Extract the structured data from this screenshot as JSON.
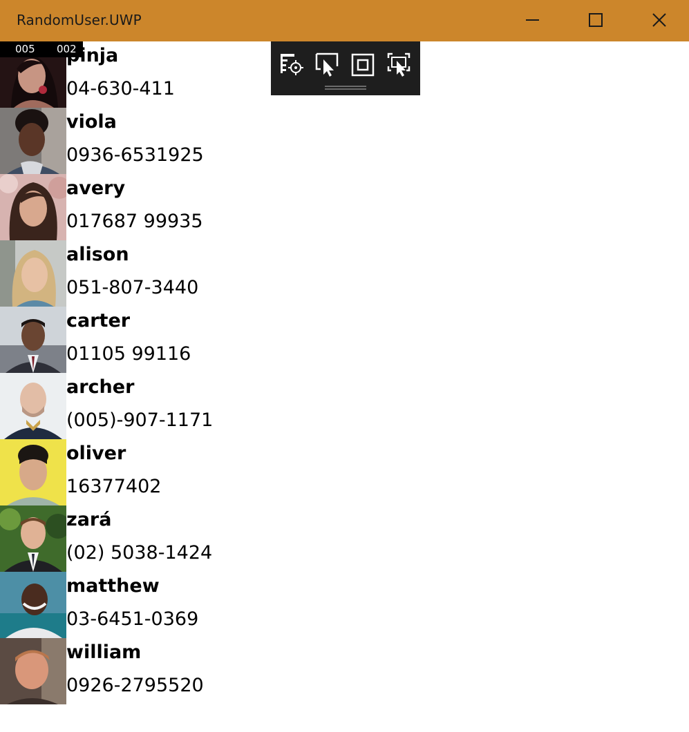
{
  "window": {
    "title": "RandomUser.UWP",
    "accent_color": "#cc862b",
    "controls": {
      "minimize_icon": "minimize-icon",
      "maximize_icon": "maximize-icon",
      "close_icon": "close-icon"
    }
  },
  "frame_counter": {
    "left_value": "005",
    "right_value": "002"
  },
  "debug_toolbar": {
    "tools": [
      {
        "icon": "go-to-live-visual-tree-icon"
      },
      {
        "icon": "select-element-icon"
      },
      {
        "icon": "display-layout-adorners-icon"
      },
      {
        "icon": "track-focused-element-icon"
      }
    ]
  },
  "users": [
    {
      "name": "pinja",
      "phone": "04-630-411",
      "avatar": "user-photo"
    },
    {
      "name": "viola",
      "phone": "0936-6531925",
      "avatar": "user-photo"
    },
    {
      "name": "avery",
      "phone": "017687 99935",
      "avatar": "user-photo"
    },
    {
      "name": "alison",
      "phone": "051-807-3440",
      "avatar": "user-photo"
    },
    {
      "name": "carter",
      "phone": "01105 99116",
      "avatar": "user-photo"
    },
    {
      "name": "archer",
      "phone": "(005)-907-1171",
      "avatar": "user-photo"
    },
    {
      "name": "oliver",
      "phone": "16377402",
      "avatar": "user-photo"
    },
    {
      "name": "zará",
      "phone": "(02) 5038-1424",
      "avatar": "user-photo"
    },
    {
      "name": "matthew",
      "phone": "03-6451-0369",
      "avatar": "user-photo"
    },
    {
      "name": "william",
      "phone": "0926-2795520",
      "avatar": "user-photo"
    }
  ]
}
